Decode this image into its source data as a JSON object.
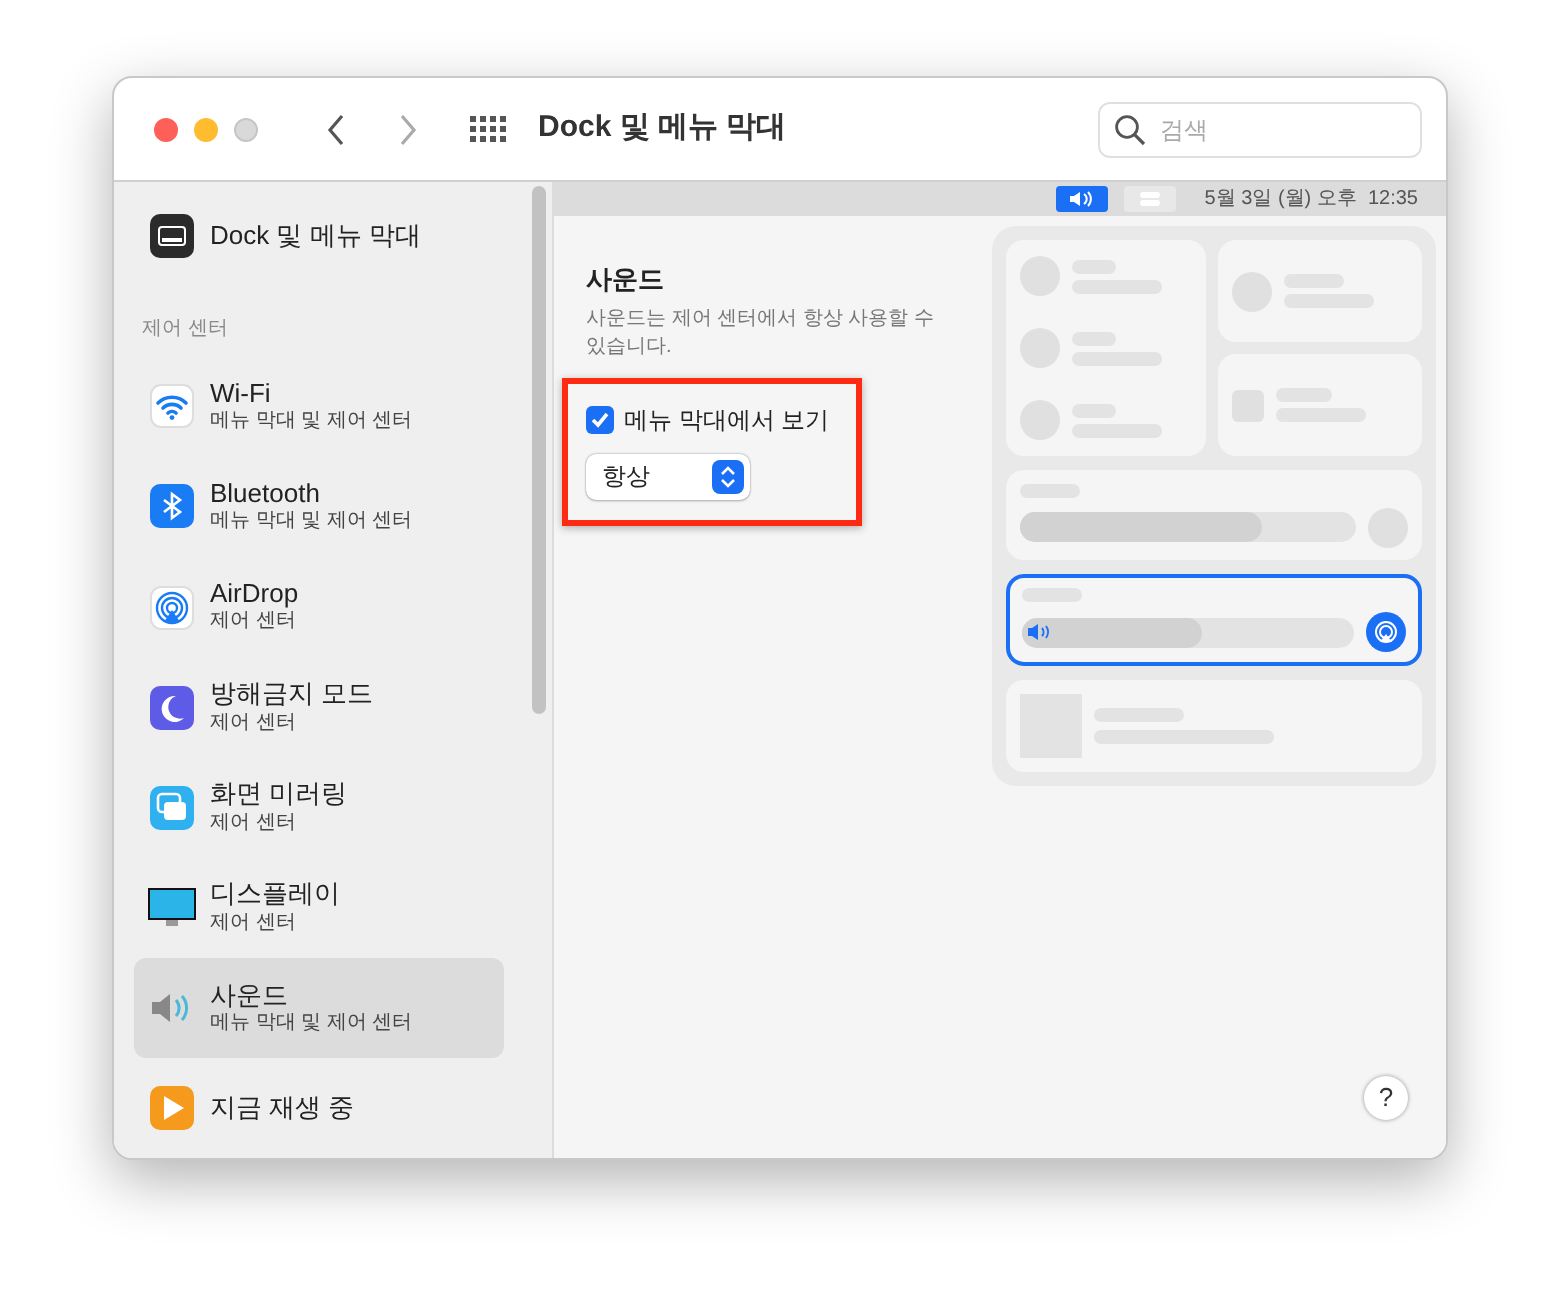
{
  "window": {
    "title": "Dock 및 메뉴 막대"
  },
  "search": {
    "placeholder": "검색"
  },
  "sidebar": {
    "items": [
      {
        "kind": "dock",
        "label": "Dock 및 메뉴 막대",
        "selected": false
      },
      {
        "kind": "header",
        "label": "제어 센터"
      },
      {
        "kind": "wifi",
        "label": "Wi-Fi",
        "subtitle": "메뉴 막대 및 제어 센터",
        "selected": false
      },
      {
        "kind": "bluetooth",
        "label": "Bluetooth",
        "subtitle": "메뉴 막대 및 제어 센터",
        "selected": false
      },
      {
        "kind": "airdrop",
        "label": "AirDrop",
        "subtitle": "제어 센터",
        "selected": false
      },
      {
        "kind": "focus",
        "label": "방해금지 모드",
        "subtitle": "제어 센터",
        "selected": false
      },
      {
        "kind": "mirroring",
        "label": "화면 미러링",
        "subtitle": "제어 센터",
        "selected": false
      },
      {
        "kind": "display",
        "label": "디스플레이",
        "subtitle": "제어 센터",
        "selected": false
      },
      {
        "kind": "sound",
        "label": "사운드",
        "subtitle": "메뉴 막대 및 제어 센터",
        "selected": true
      },
      {
        "kind": "nowplaying",
        "label": "지금 재생 중",
        "selected": false
      }
    ]
  },
  "menu_bar": {
    "clock": "5월 3일 (월) 오후  12:35"
  },
  "content": {
    "title": "사운드",
    "description": "사운드는 제어 센터에서 항상 사용할 수 있습니다.",
    "checkbox": {
      "label": "메뉴 막대에서 보기",
      "checked": true
    },
    "select": {
      "value": "항상"
    }
  },
  "help": "?"
}
